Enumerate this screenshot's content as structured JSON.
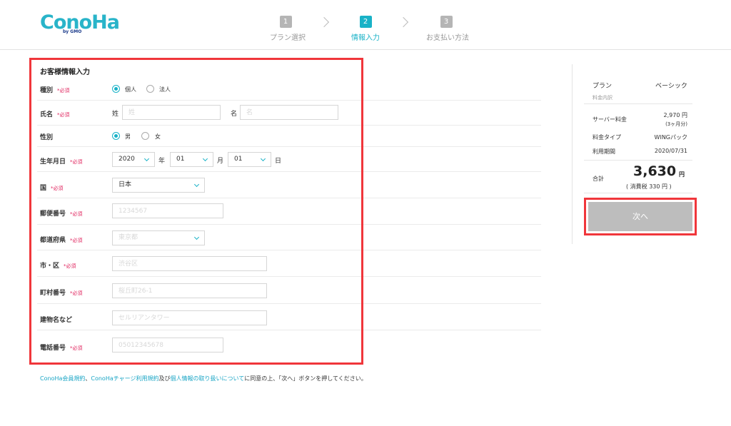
{
  "header": {
    "logo": "ConoHa",
    "logo_sub": "by GMO",
    "steps": [
      {
        "num": "1",
        "label": "プラン選択"
      },
      {
        "num": "2",
        "label": "情報入力"
      },
      {
        "num": "3",
        "label": "お支払い方法"
      }
    ]
  },
  "form": {
    "title": "お客様情報入力",
    "required_mark": "*必須",
    "type": {
      "label": "種別",
      "options": [
        "個人",
        "法人"
      ],
      "selected": "個人"
    },
    "name": {
      "label": "氏名",
      "last_label": "姓",
      "last_placeholder": "姓",
      "first_label": "名",
      "first_placeholder": "名"
    },
    "gender": {
      "label": "性別",
      "options": [
        "男",
        "女"
      ],
      "selected": "男"
    },
    "birthdate": {
      "label": "生年月日",
      "year": "2020",
      "year_unit": "年",
      "month": "01",
      "month_unit": "月",
      "day": "01",
      "day_unit": "日"
    },
    "country": {
      "label": "国",
      "value": "日本"
    },
    "postal": {
      "label": "郵便番号",
      "placeholder": "1234567"
    },
    "prefecture": {
      "label": "都道府県",
      "placeholder": "東京都"
    },
    "city": {
      "label": "市・区",
      "placeholder": "渋谷区"
    },
    "town": {
      "label": "町村番号",
      "placeholder": "桜丘町26-1"
    },
    "building": {
      "label": "建物名など",
      "placeholder": "セルリアンタワー"
    },
    "phone": {
      "label": "電話番号",
      "placeholder": "05012345678"
    }
  },
  "terms": {
    "link1": "ConoHa会員規約",
    "sep1": "、",
    "link2": "ConoHaチャージ利用規約",
    "sep2": "及び",
    "link3": "個人情報の取り扱いについて",
    "text": "に同意の上、「次へ」ボタンを押してください。"
  },
  "summary": {
    "plan_label": "プラン",
    "plan_value": "ベーシック",
    "breakdown_label": "料金内訳",
    "server_fee_label": "サーバー料金",
    "server_fee_value": "2,970 円",
    "server_fee_note": "(3ヶ月分)",
    "fee_type_label": "料金タイプ",
    "fee_type_value": "WINGパック",
    "period_label": "利用期間",
    "period_value": "2020/07/31",
    "total_label": "合計",
    "total_amount": "3,630",
    "total_unit": "円",
    "tax_note": "( 消費税 330 円 )",
    "next_button": "次へ"
  },
  "colors": {
    "accent": "#19b2c7",
    "highlight": "#f0363b",
    "required": "#e0245e",
    "disabled_button": "#bdbdbd"
  }
}
